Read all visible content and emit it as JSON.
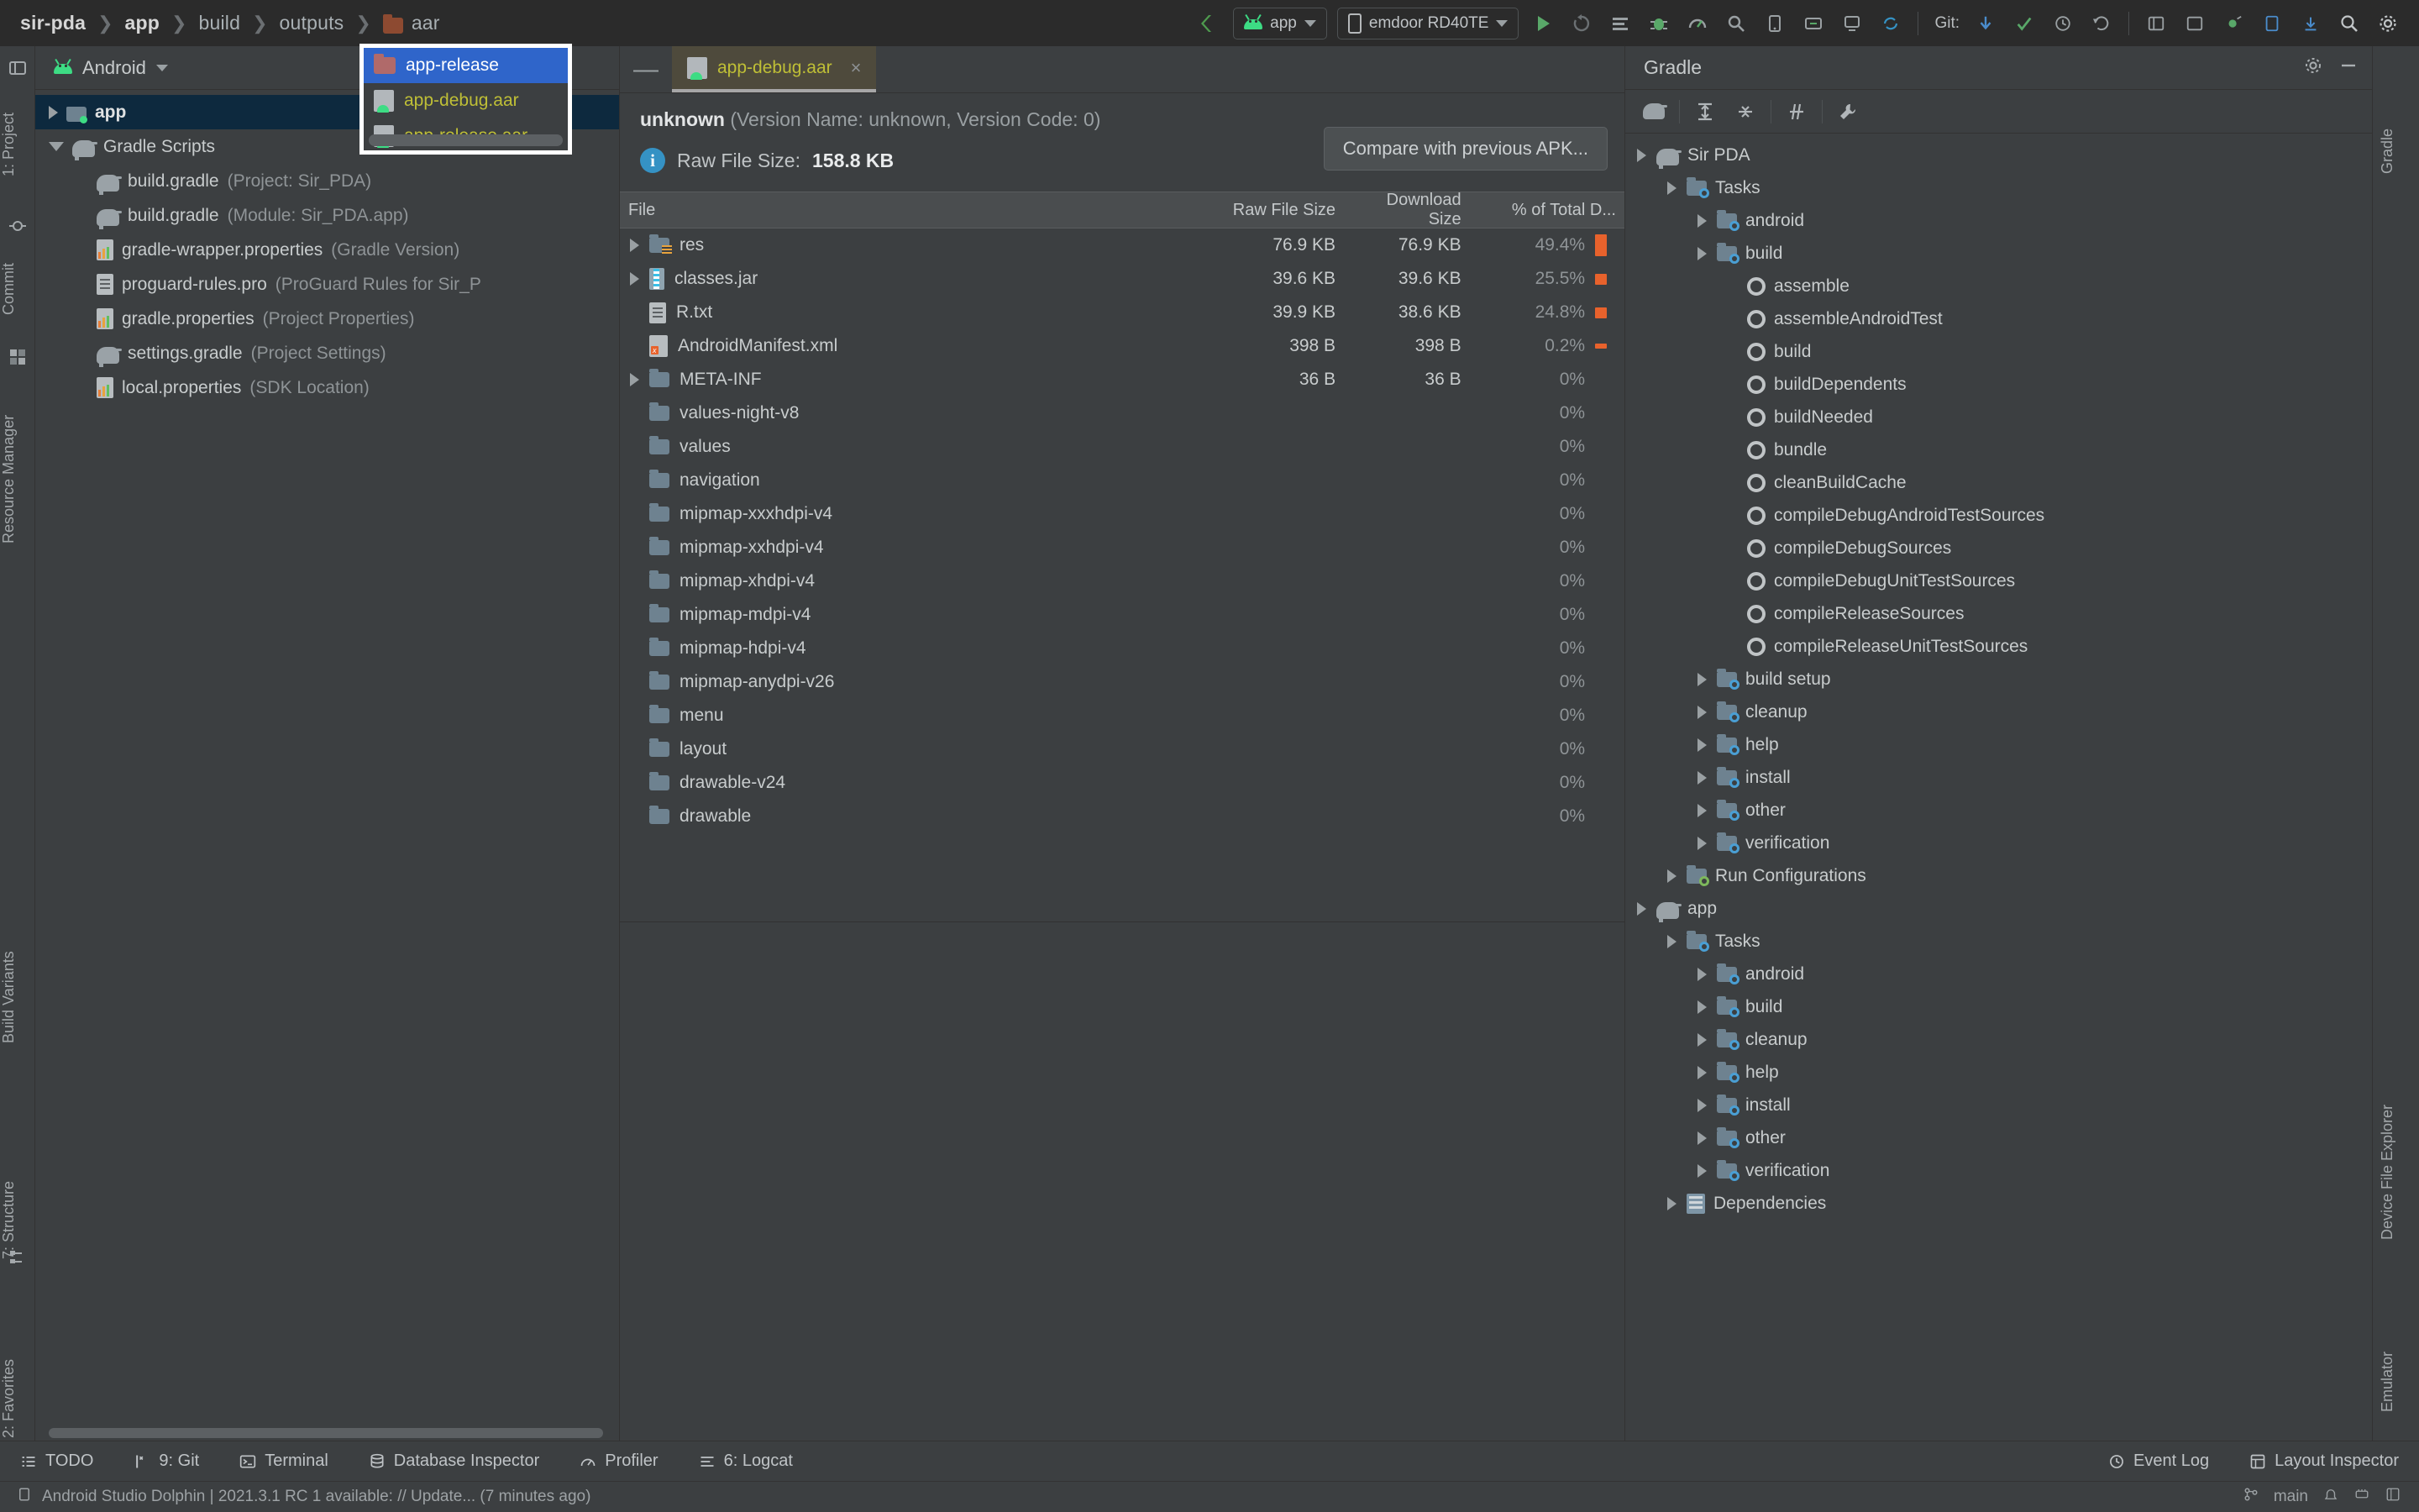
{
  "breadcrumb": {
    "items": [
      {
        "label": "sir-pda",
        "bold": true,
        "icon": null
      },
      {
        "label": "app",
        "bold": true,
        "icon": null
      },
      {
        "label": "build",
        "bold": false,
        "icon": null
      },
      {
        "label": "outputs",
        "bold": false,
        "icon": null
      },
      {
        "label": "aar",
        "bold": false,
        "icon": "folder-icon"
      }
    ]
  },
  "toolbar": {
    "build_chip": "app",
    "device_chip": "emdoor RD40TE",
    "git_label": "Git:",
    "icons": [
      "make-project-icon",
      "run-icon",
      "rerun-icon",
      "logcat-icon",
      "debug-icon",
      "profile-icon",
      "analyze-icon",
      "device-manager-icon",
      "sdk-icon",
      "avd-icon",
      "sync-icon",
      "undo-icon",
      "git-update-icon",
      "git-commit-icon",
      "git-history-icon",
      "git-rollback-icon",
      "search-icon",
      "settings-icon"
    ]
  },
  "left_rail": {
    "items": [
      {
        "label": "1: Project",
        "icon": "project-icon"
      },
      {
        "label": "Commit",
        "icon": "commit-icon"
      },
      {
        "label": "Resource Manager",
        "icon": "resource-icon"
      },
      {
        "label": "Build Variants",
        "icon": "variants-icon"
      },
      {
        "label": "7: Structure",
        "icon": "structure-icon"
      },
      {
        "label": "2: Favorites",
        "icon": "star-icon"
      }
    ]
  },
  "right_rail": {
    "items": [
      {
        "label": "Gradle",
        "icon": "gradle-icon"
      },
      {
        "label": "Device File Explorer",
        "icon": "device-file-icon"
      },
      {
        "label": "Emulator",
        "icon": "emulator-icon"
      }
    ]
  },
  "project_panel": {
    "selector": "Android",
    "tree": [
      {
        "label": "app",
        "dim": "",
        "indent": 0,
        "arrow": "closed",
        "icon": "module-folder-icon",
        "bold": true,
        "selected": true
      },
      {
        "label": "Gradle Scripts",
        "dim": "",
        "indent": 0,
        "arrow": "open",
        "icon": "gradle-elephant-icon",
        "bold": false,
        "selected": false
      },
      {
        "label": "build.gradle",
        "dim": "(Project: Sir_PDA)",
        "indent": 1,
        "arrow": "none",
        "icon": "gradle-elephant-icon",
        "bold": false,
        "selected": false
      },
      {
        "label": "build.gradle",
        "dim": "(Module: Sir_PDA.app)",
        "indent": 1,
        "arrow": "none",
        "icon": "gradle-elephant-icon",
        "bold": false,
        "selected": false
      },
      {
        "label": "gradle-wrapper.properties",
        "dim": "(Gradle Version)",
        "indent": 1,
        "arrow": "none",
        "icon": "properties-icon",
        "bold": false,
        "selected": false
      },
      {
        "label": "proguard-rules.pro",
        "dim": "(ProGuard Rules for Sir_P",
        "indent": 1,
        "arrow": "none",
        "icon": "document-icon",
        "bold": false,
        "selected": false
      },
      {
        "label": "gradle.properties",
        "dim": "(Project Properties)",
        "indent": 1,
        "arrow": "none",
        "icon": "properties-icon",
        "bold": false,
        "selected": false
      },
      {
        "label": "settings.gradle",
        "dim": "(Project Settings)",
        "indent": 1,
        "arrow": "none",
        "icon": "gradle-elephant-icon",
        "bold": false,
        "selected": false
      },
      {
        "label": "local.properties",
        "dim": "(SDK Location)",
        "indent": 1,
        "arrow": "none",
        "icon": "properties-icon",
        "bold": false,
        "selected": false
      }
    ]
  },
  "popup_menu": {
    "items": [
      {
        "label": "app-release",
        "icon": "folder-icon",
        "selected": true
      },
      {
        "label": "app-debug.aar",
        "icon": "aar-file-icon",
        "selected": false
      },
      {
        "label": "app-release.aar",
        "icon": "aar-file-icon",
        "selected": false
      }
    ]
  },
  "editor": {
    "tab": {
      "label": "app-debug.aar",
      "icon": "aar-file-icon",
      "close": "×"
    },
    "apk_name": "unknown",
    "apk_meta": "(Version Name: unknown, Version Code: 0)",
    "raw_size_label": "Raw File Size:",
    "raw_size_value": "158.8 KB",
    "compare_button": "Compare with previous APK...",
    "columns": [
      "File",
      "Raw File Size",
      "Download Size",
      "% of Total D..."
    ],
    "rows": [
      {
        "file": "res",
        "raw": "76.9 KB",
        "dl": "76.9 KB",
        "pct": "49.4%",
        "barpct": 49.4,
        "arrow": "closed",
        "icon": "res-folder-icon"
      },
      {
        "file": "classes.jar",
        "raw": "39.6 KB",
        "dl": "39.6 KB",
        "pct": "25.5%",
        "barpct": 25.5,
        "arrow": "closed",
        "icon": "jar-icon"
      },
      {
        "file": "R.txt",
        "raw": "39.9 KB",
        "dl": "38.6 KB",
        "pct": "24.8%",
        "barpct": 24.8,
        "arrow": "none",
        "icon": "document-icon"
      },
      {
        "file": "AndroidManifest.xml",
        "raw": "398 B",
        "dl": "398 B",
        "pct": "0.2%",
        "barpct": 0.2,
        "arrow": "none",
        "icon": "xml-icon"
      },
      {
        "file": "META-INF",
        "raw": "36 B",
        "dl": "36 B",
        "pct": "0%",
        "barpct": 0,
        "arrow": "closed",
        "icon": "folder-icon"
      },
      {
        "file": "values-night-v8",
        "raw": "",
        "dl": "",
        "pct": "0%",
        "barpct": 0,
        "arrow": "none",
        "icon": "folder-icon"
      },
      {
        "file": "values",
        "raw": "",
        "dl": "",
        "pct": "0%",
        "barpct": 0,
        "arrow": "none",
        "icon": "folder-icon"
      },
      {
        "file": "navigation",
        "raw": "",
        "dl": "",
        "pct": "0%",
        "barpct": 0,
        "arrow": "none",
        "icon": "folder-icon"
      },
      {
        "file": "mipmap-xxxhdpi-v4",
        "raw": "",
        "dl": "",
        "pct": "0%",
        "barpct": 0,
        "arrow": "none",
        "icon": "folder-icon"
      },
      {
        "file": "mipmap-xxhdpi-v4",
        "raw": "",
        "dl": "",
        "pct": "0%",
        "barpct": 0,
        "arrow": "none",
        "icon": "folder-icon"
      },
      {
        "file": "mipmap-xhdpi-v4",
        "raw": "",
        "dl": "",
        "pct": "0%",
        "barpct": 0,
        "arrow": "none",
        "icon": "folder-icon"
      },
      {
        "file": "mipmap-mdpi-v4",
        "raw": "",
        "dl": "",
        "pct": "0%",
        "barpct": 0,
        "arrow": "none",
        "icon": "folder-icon"
      },
      {
        "file": "mipmap-hdpi-v4",
        "raw": "",
        "dl": "",
        "pct": "0%",
        "barpct": 0,
        "arrow": "none",
        "icon": "folder-icon"
      },
      {
        "file": "mipmap-anydpi-v26",
        "raw": "",
        "dl": "",
        "pct": "0%",
        "barpct": 0,
        "arrow": "none",
        "icon": "folder-icon"
      },
      {
        "file": "menu",
        "raw": "",
        "dl": "",
        "pct": "0%",
        "barpct": 0,
        "arrow": "none",
        "icon": "folder-icon"
      },
      {
        "file": "layout",
        "raw": "",
        "dl": "",
        "pct": "0%",
        "barpct": 0,
        "arrow": "none",
        "icon": "folder-icon"
      },
      {
        "file": "drawable-v24",
        "raw": "",
        "dl": "",
        "pct": "0%",
        "barpct": 0,
        "arrow": "none",
        "icon": "folder-icon"
      },
      {
        "file": "drawable",
        "raw": "",
        "dl": "",
        "pct": "0%",
        "barpct": 0,
        "arrow": "none",
        "icon": "folder-icon"
      }
    ]
  },
  "gradle_panel": {
    "title": "Gradle",
    "tools": [
      "gradle-sync-icon",
      "expand-all-icon",
      "collapse-all-icon",
      "toggle-offline-icon",
      "gradle-settings-icon"
    ],
    "head_icons": [
      "settings-icon",
      "minimize-icon"
    ],
    "tree": [
      {
        "label": "Sir PDA",
        "indent": 0,
        "arrow": "open",
        "icon": "gradle-elephant-icon"
      },
      {
        "label": "Tasks",
        "indent": 1,
        "arrow": "open",
        "icon": "task-folder-icon"
      },
      {
        "label": "android",
        "indent": 2,
        "arrow": "closed",
        "icon": "task-folder-icon"
      },
      {
        "label": "build",
        "indent": 2,
        "arrow": "open",
        "icon": "task-folder-icon"
      },
      {
        "label": "assemble",
        "indent": 3,
        "arrow": "none",
        "icon": "gear-icon"
      },
      {
        "label": "assembleAndroidTest",
        "indent": 3,
        "arrow": "none",
        "icon": "gear-icon"
      },
      {
        "label": "build",
        "indent": 3,
        "arrow": "none",
        "icon": "gear-icon"
      },
      {
        "label": "buildDependents",
        "indent": 3,
        "arrow": "none",
        "icon": "gear-icon"
      },
      {
        "label": "buildNeeded",
        "indent": 3,
        "arrow": "none",
        "icon": "gear-icon"
      },
      {
        "label": "bundle",
        "indent": 3,
        "arrow": "none",
        "icon": "gear-icon"
      },
      {
        "label": "cleanBuildCache",
        "indent": 3,
        "arrow": "none",
        "icon": "gear-icon"
      },
      {
        "label": "compileDebugAndroidTestSources",
        "indent": 3,
        "arrow": "none",
        "icon": "gear-icon"
      },
      {
        "label": "compileDebugSources",
        "indent": 3,
        "arrow": "none",
        "icon": "gear-icon"
      },
      {
        "label": "compileDebugUnitTestSources",
        "indent": 3,
        "arrow": "none",
        "icon": "gear-icon"
      },
      {
        "label": "compileReleaseSources",
        "indent": 3,
        "arrow": "none",
        "icon": "gear-icon"
      },
      {
        "label": "compileReleaseUnitTestSources",
        "indent": 3,
        "arrow": "none",
        "icon": "gear-icon"
      },
      {
        "label": "build setup",
        "indent": 2,
        "arrow": "closed",
        "icon": "task-folder-icon"
      },
      {
        "label": "cleanup",
        "indent": 2,
        "arrow": "closed",
        "icon": "task-folder-icon"
      },
      {
        "label": "help",
        "indent": 2,
        "arrow": "closed",
        "icon": "task-folder-icon"
      },
      {
        "label": "install",
        "indent": 2,
        "arrow": "closed",
        "icon": "task-folder-icon"
      },
      {
        "label": "other",
        "indent": 2,
        "arrow": "closed",
        "icon": "task-folder-icon"
      },
      {
        "label": "verification",
        "indent": 2,
        "arrow": "closed",
        "icon": "task-folder-icon"
      },
      {
        "label": "Run Configurations",
        "indent": 1,
        "arrow": "closed",
        "icon": "run-config-icon"
      },
      {
        "label": "app",
        "indent": 0,
        "arrow": "open",
        "icon": "gradle-elephant-icon"
      },
      {
        "label": "Tasks",
        "indent": 1,
        "arrow": "open",
        "icon": "task-folder-icon"
      },
      {
        "label": "android",
        "indent": 2,
        "arrow": "closed",
        "icon": "task-folder-icon"
      },
      {
        "label": "build",
        "indent": 2,
        "arrow": "closed",
        "icon": "task-folder-icon"
      },
      {
        "label": "cleanup",
        "indent": 2,
        "arrow": "closed",
        "icon": "task-folder-icon"
      },
      {
        "label": "help",
        "indent": 2,
        "arrow": "closed",
        "icon": "task-folder-icon"
      },
      {
        "label": "install",
        "indent": 2,
        "arrow": "closed",
        "icon": "task-folder-icon"
      },
      {
        "label": "other",
        "indent": 2,
        "arrow": "closed",
        "icon": "task-folder-icon"
      },
      {
        "label": "verification",
        "indent": 2,
        "arrow": "closed",
        "icon": "task-folder-icon"
      },
      {
        "label": "Dependencies",
        "indent": 1,
        "arrow": "closed",
        "icon": "dependencies-icon"
      }
    ]
  },
  "bottom_bar": {
    "items": [
      {
        "label": "TODO",
        "icon": "todo-icon",
        "num": ""
      },
      {
        "label": "9: Git",
        "icon": "git-icon",
        "num": "9"
      },
      {
        "label": "Terminal",
        "icon": "terminal-icon",
        "num": ""
      },
      {
        "label": "Database Inspector",
        "icon": "database-icon",
        "num": ""
      },
      {
        "label": "Profiler",
        "icon": "profiler-icon",
        "num": ""
      },
      {
        "label": "6: Logcat",
        "icon": "logcat-icon",
        "num": "6"
      }
    ],
    "right": [
      {
        "label": "Event Log",
        "icon": "event-log-icon"
      },
      {
        "label": "Layout Inspector",
        "icon": "layout-inspector-icon"
      }
    ]
  },
  "status_bar": {
    "message": "Android Studio Dolphin | 2021.3.1 RC 1 available: // Update... (7 minutes ago)",
    "branch": "main",
    "icons": [
      "notifications-icon",
      "memory-icon"
    ]
  }
}
